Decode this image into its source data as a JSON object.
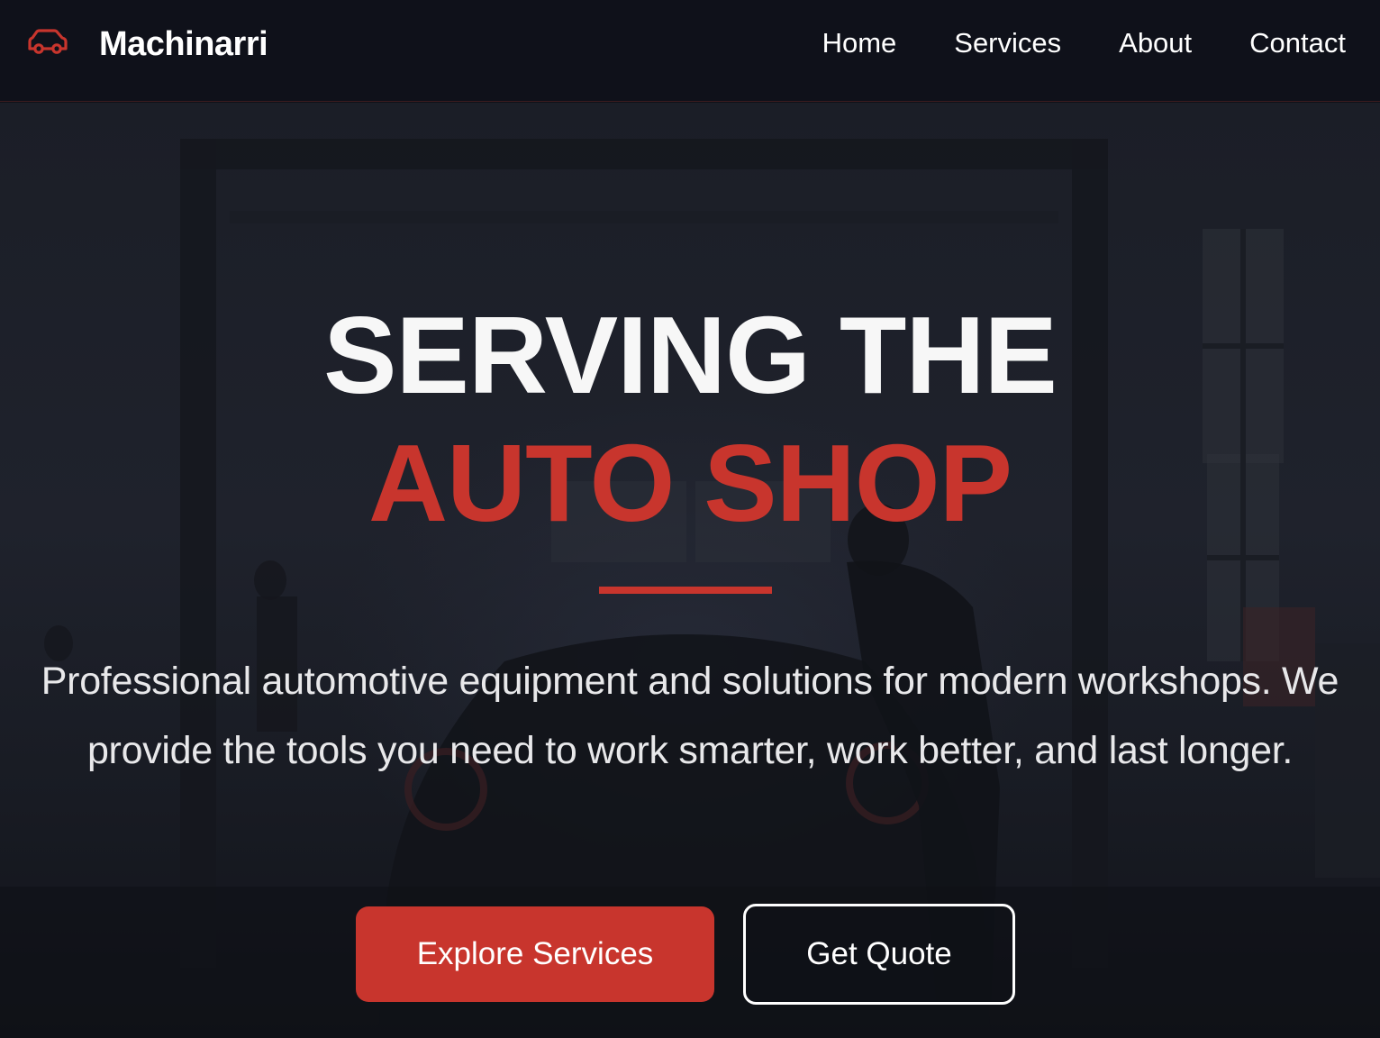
{
  "header": {
    "brand_name": "Machinarri",
    "brand_icon": "car-icon",
    "nav": [
      {
        "label": "Home"
      },
      {
        "label": "Services"
      },
      {
        "label": "About"
      },
      {
        "label": "Contact"
      }
    ]
  },
  "hero": {
    "headline_line1": "SERVING THE",
    "headline_line2": "AUTO SHOP",
    "subtitle": "Professional automotive equipment and solutions for modern workshops. We provide the tools you need to work smarter, work better, and last longer.",
    "primary_button": "Explore Services",
    "secondary_button": "Get Quote",
    "background_image": "dark auto workshop photo with mechanic and car on lift"
  },
  "colors": {
    "accent": "#c8352d",
    "nav_background": "#0f111a",
    "text_primary": "#ffffff"
  }
}
